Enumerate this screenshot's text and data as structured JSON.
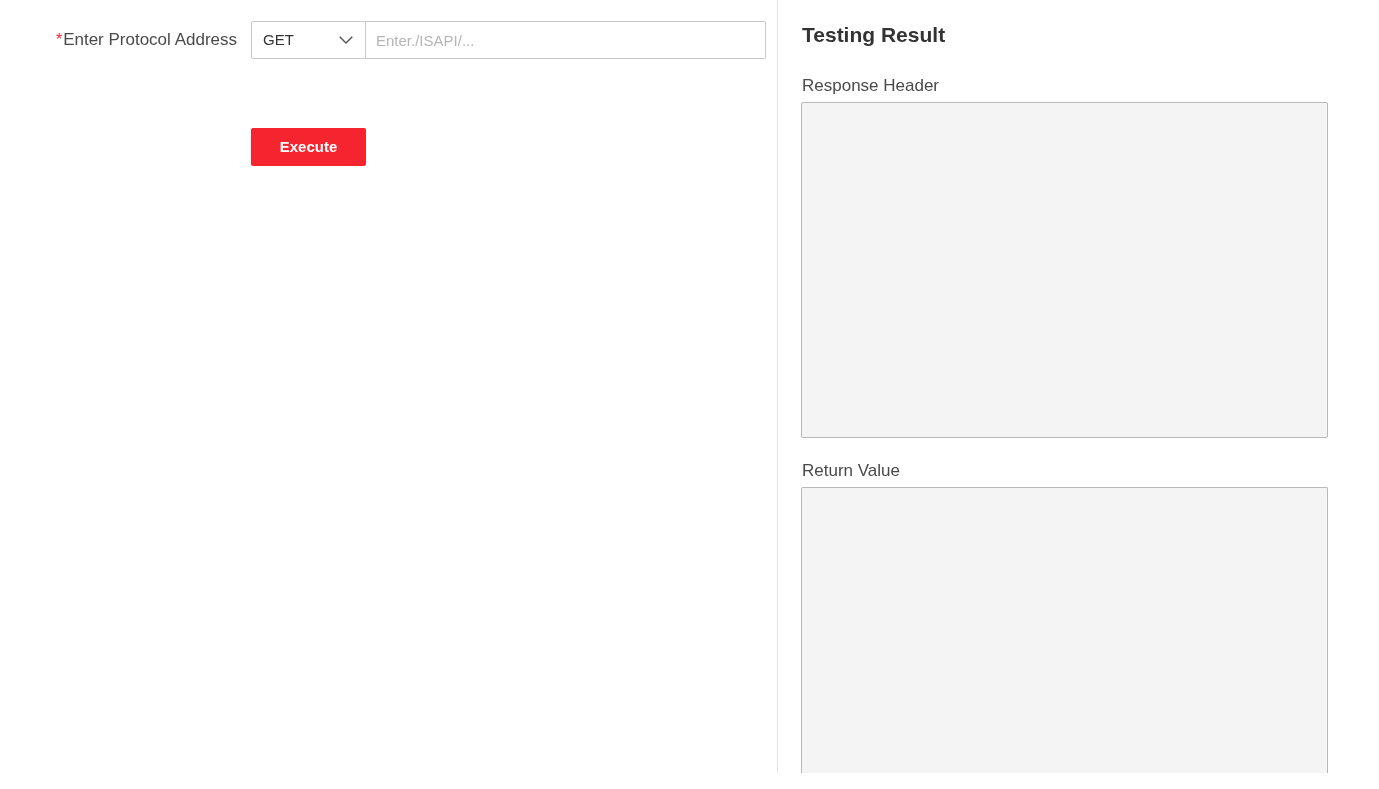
{
  "request_form": {
    "protocol_address": {
      "required_mark": "*",
      "label": "Enter Protocol Address",
      "method": "GET",
      "placeholder": "Enter./ISAPI/..."
    },
    "execute_button": "Execute"
  },
  "testing_result": {
    "title": "Testing Result",
    "fields": [
      {
        "label": "Response Header"
      },
      {
        "label": "Return Value"
      }
    ]
  }
}
